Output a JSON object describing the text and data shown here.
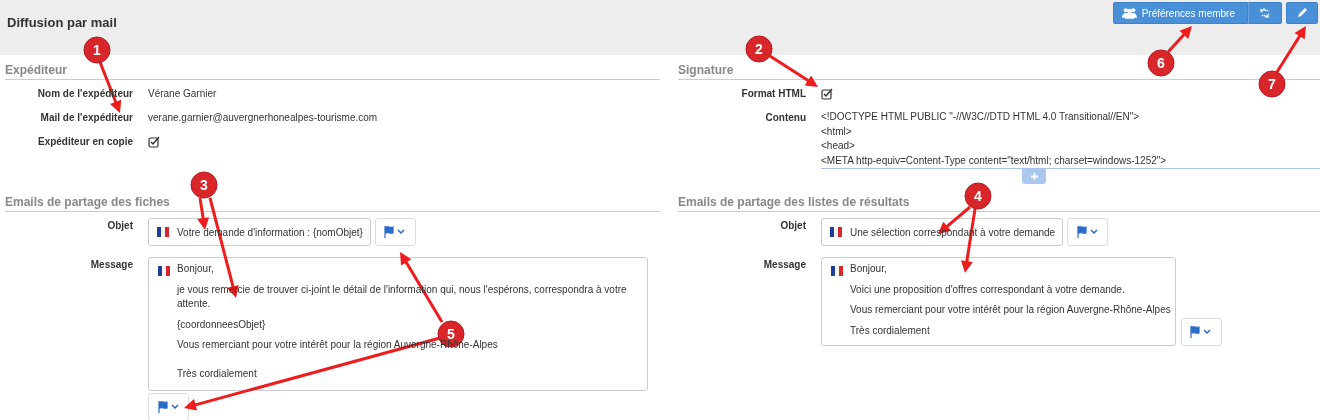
{
  "header": {
    "title": "Diffusion par mail",
    "buttons": [
      {
        "kind": "preferences",
        "label": "Préférences membre"
      },
      {
        "kind": "split"
      },
      {
        "kind": "edit"
      }
    ]
  },
  "sender": {
    "heading": "Expéditeur",
    "fields": [
      {
        "kind": "text",
        "label": "Nom de l'expéditeur",
        "value": "Vérane Garnier"
      },
      {
        "kind": "text",
        "label": "Mail de l'expéditeur",
        "value": "verane.garnier@auvergnerhonealpes-tourisme.com"
      },
      {
        "kind": "checkbox",
        "label": "Expéditeur en copie",
        "checked": true
      }
    ]
  },
  "signature": {
    "heading": "Signature",
    "fields": [
      {
        "kind": "checkbox",
        "label": "Format HTML",
        "checked": true
      },
      {
        "kind": "code",
        "label": "Contenu",
        "lines": [
          "<!DOCTYPE HTML PUBLIC \"-//W3C//DTD HTML 4.0 Transitional//EN\">",
          "<html>",
          "<head>",
          "<META http-equiv=Content-Type content=\"text/html; charset=windows-1252\">"
        ]
      }
    ]
  },
  "sheet_emails": {
    "heading": "Emails de partage des fiches",
    "subject": {
      "label": "Objet",
      "value": "Votre demande d'information : {nomObjet}"
    },
    "message": {
      "label": "Message",
      "paragraphs": [
        {
          "text": "Bonjour,",
          "spaced": false
        },
        {
          "text": "je vous remercie de trouver ci-joint le détail de l'information qui, nous l'espérons, correspondra à votre attente.",
          "spaced": false
        },
        {
          "text": "{coordonneesObjet}",
          "spaced": false
        },
        {
          "text": "Vous remerciant pour votre intérêt pour la région Auvergne-Rhône-Alpes",
          "spaced": false
        },
        {
          "text": "Très cordialement",
          "spaced": true
        }
      ]
    }
  },
  "list_emails": {
    "heading": "Emails de partage des listes de résultats",
    "subject": {
      "label": "Objet",
      "value": "Une sélection correspondant à votre demande"
    },
    "message": {
      "label": "Message",
      "paragraphs": [
        {
          "text": "Bonjour,",
          "spaced": false
        },
        {
          "text": "Voici une proposition d'offres correspondant à votre demande.",
          "spaced": false
        },
        {
          "text": "Vous remerciant pour votre intérêt pour la région Auvergne-Rhône-Alpes",
          "spaced": false
        },
        {
          "text": "Très cordialement",
          "spaced": false
        }
      ]
    }
  },
  "annotations": [
    {
      "number": "1"
    },
    {
      "number": "2"
    },
    {
      "number": "3"
    },
    {
      "number": "4"
    },
    {
      "number": "5"
    },
    {
      "number": "6"
    },
    {
      "number": "7"
    }
  ]
}
